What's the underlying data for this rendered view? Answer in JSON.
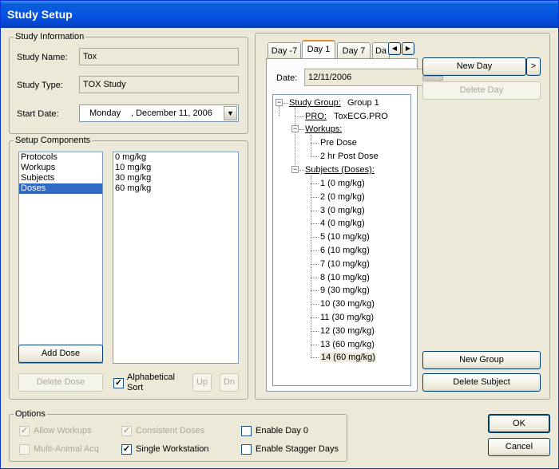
{
  "window": {
    "title": "Study Setup"
  },
  "study_info": {
    "legend": "Study Information",
    "name_label": "Study Name:",
    "name_value": "Tox",
    "type_label": "Study Type:",
    "type_value": "TOX Study",
    "start_label": "Start Date:",
    "start_day": "Monday",
    "start_date": ", December 11, 2006"
  },
  "setup": {
    "legend": "Setup Components",
    "components": [
      "Protocols",
      "Workups",
      "Subjects",
      "Doses"
    ],
    "selected_component": "Doses",
    "doses": [
      "0 mg/kg",
      "10 mg/kg",
      "30 mg/kg",
      "60 mg/kg"
    ],
    "add_label": "Add Dose",
    "delete_label": "Delete Dose",
    "alpha_sort_line1": "Alphabetical",
    "alpha_sort_line2": "Sort",
    "up_label": "Up",
    "dn_label": "Dn"
  },
  "day_panel": {
    "tabs": [
      "Day -7",
      "Day 1",
      "Day 7",
      "Da"
    ],
    "active_tab": "Day 1",
    "date_label": "Date:",
    "date_value": "12/11/2006",
    "new_day_label": "New Day",
    "more_label": ">",
    "delete_day_label": "Delete Day",
    "new_group_label": "New Group",
    "delete_subject_label": "Delete Subject"
  },
  "tree": {
    "group_label": "Study Group:",
    "group_value": "Group 1",
    "pro_label": "PRO:",
    "pro_value": "ToxECG.PRO",
    "workups_label": "Workups:",
    "workups": [
      "Pre Dose",
      "2 hr Post Dose"
    ],
    "subjects_label": "Subjects (Doses):",
    "subjects": [
      "1 (0 mg/kg)",
      "2 (0 mg/kg)",
      "3 (0 mg/kg)",
      "4 (0 mg/kg)",
      "5 (10 mg/kg)",
      "6 (10 mg/kg)",
      "7 (10 mg/kg)",
      "8 (10 mg/kg)",
      "9 (30 mg/kg)",
      "10 (30 mg/kg)",
      "11 (30 mg/kg)",
      "12 (30 mg/kg)",
      "13 (60 mg/kg)",
      "14 (60 mg/kg)"
    ]
  },
  "options": {
    "legend": "Options",
    "allow_workups": "Allow Workups",
    "consistent_doses": "Consistent Doses",
    "enable_day0": "Enable Day 0",
    "multi_animal": "Multi-Animal Acq",
    "single_workstation": "Single Workstation",
    "enable_stagger": "Enable Stagger Days"
  },
  "footer": {
    "ok_label": "OK",
    "cancel_label": "Cancel"
  }
}
